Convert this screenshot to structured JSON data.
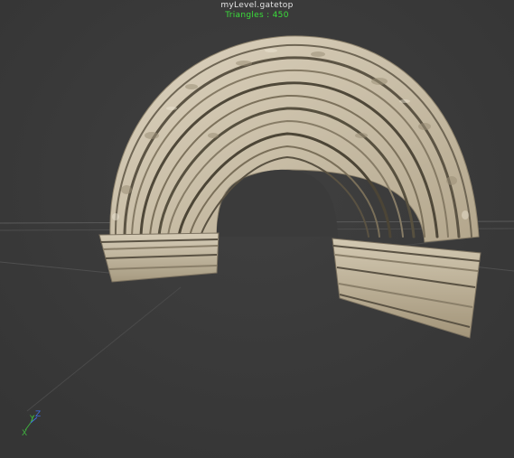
{
  "viewport": {
    "model_name": "myLevel.gatetop",
    "triangle_count": "Triangles : 450",
    "background_color": "#3b3b3b"
  },
  "axis_gizmo": {
    "x_label": "X",
    "y_label": "Y",
    "z_label": "Z",
    "x_color": "#3fb13f",
    "y_color": "#3fb13f",
    "z_color": "#3f6fe0"
  },
  "model": {
    "name": "stone-arch-mesh",
    "material_color": "#cfc4ae"
  }
}
